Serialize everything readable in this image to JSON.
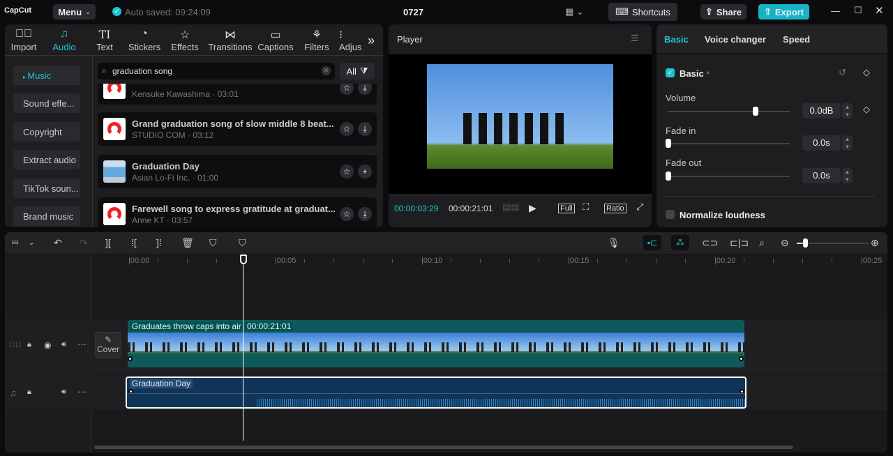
{
  "app": {
    "logo": "CapCut",
    "menu": "Menu",
    "autosave": "Auto saved: 09:24:09",
    "project_title": "0727",
    "shortcuts": "Shortcuts",
    "share": "Share",
    "export": "Export"
  },
  "toolbar": [
    {
      "label": "Import",
      "icon": "import-icon"
    },
    {
      "label": "Audio",
      "icon": "audio-icon",
      "active": true
    },
    {
      "label": "Text",
      "icon": "text-icon"
    },
    {
      "label": "Stickers",
      "icon": "stickers-icon"
    },
    {
      "label": "Effects",
      "icon": "effects-icon"
    },
    {
      "label": "Transitions",
      "icon": "transitions-icon"
    },
    {
      "label": "Captions",
      "icon": "captions-icon"
    },
    {
      "label": "Filters",
      "icon": "filters-icon"
    },
    {
      "label": "Adjus",
      "icon": "adjust-icon"
    }
  ],
  "categories": [
    "Music",
    "Sound effe...",
    "Copyright",
    "Extract audio",
    "TikTok soun...",
    "Brand music"
  ],
  "search": {
    "value": "graduation song",
    "filter": "All"
  },
  "songs": [
    {
      "title": "",
      "sub": "Kensuke Kawashima · 03:01",
      "action": "download"
    },
    {
      "title": "Grand graduation song of slow middle 8 beat...",
      "sub": "STUDIO COM · 03:12",
      "action": "download"
    },
    {
      "title": "Graduation Day",
      "sub": "Asian Lo-Fi Inc. · 01:00",
      "action": "add"
    },
    {
      "title": "Farewell song to express gratitude at graduat...",
      "sub": "Anne KT · 03:57",
      "action": "download"
    }
  ],
  "player": {
    "title": "Player",
    "current": "00:00:03:29",
    "total": "00:00:21:01",
    "full": "Full",
    "ratio": "Ratio"
  },
  "inspector": {
    "tabs": [
      "Basic",
      "Voice changer",
      "Speed"
    ],
    "section": "Basic",
    "volume_label": "Volume",
    "volume": "0.0dB",
    "volume_fraction": 0.72,
    "fadein_label": "Fade in",
    "fadein": "0.0s",
    "fadeout_label": "Fade out",
    "fadeout": "0.0s",
    "normalize": "Normalize loudness"
  },
  "timeline": {
    "ticks": [
      "00:00",
      "00:05",
      "00:10",
      "00:15",
      "00:20",
      "00:25"
    ],
    "video_clip": "Graduates throw caps into air",
    "video_duration": "00:00:21:01",
    "audio_clip": "Graduation Day",
    "cover": "Cover",
    "zoom_fraction": 0.12
  },
  "colors": {
    "accent": "#1fc3d0",
    "export": "#16b3c7"
  }
}
